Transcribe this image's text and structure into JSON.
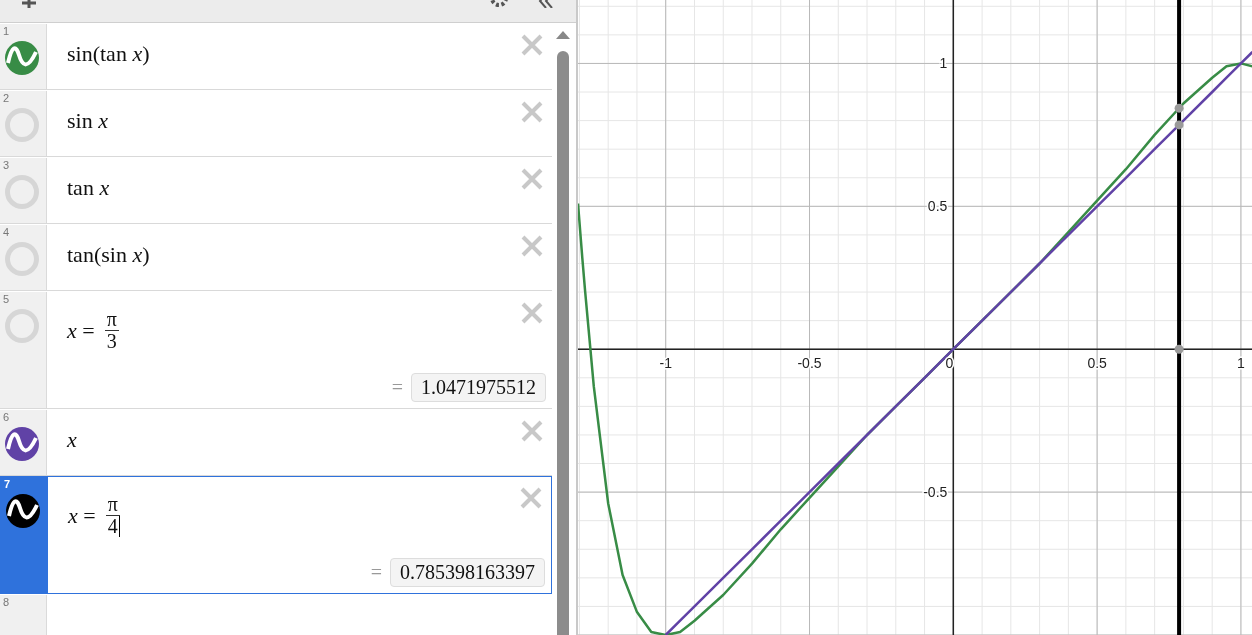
{
  "expressions": [
    {
      "number": "1",
      "kind": "plain",
      "text": "sin(tan *x*)",
      "visible": true,
      "color": "#388c46",
      "selected": false
    },
    {
      "number": "2",
      "kind": "plain",
      "text": "sin *x*",
      "visible": false,
      "selected": false
    },
    {
      "number": "3",
      "kind": "plain",
      "text": "tan *x*",
      "visible": false,
      "selected": false
    },
    {
      "number": "4",
      "kind": "plain",
      "text": "tan(sin *x*)",
      "visible": false,
      "selected": false
    },
    {
      "number": "5",
      "kind": "fraction",
      "lhs": "*x* =",
      "numerator": "π",
      "denominator": "3",
      "equals": "=",
      "result": "1.0471975512",
      "visible": false,
      "selected": false
    },
    {
      "number": "6",
      "kind": "plain",
      "text": "*x*",
      "visible": true,
      "color": "#6042a6",
      "selected": false
    },
    {
      "number": "7",
      "kind": "fraction",
      "lhs": "*x* =",
      "numerator": "π",
      "denominator": "4",
      "equals": "=",
      "result": "0.785398163397",
      "visible": true,
      "color": "#000000",
      "selected": true
    },
    {
      "number": "8",
      "kind": "empty",
      "selected": false
    }
  ],
  "graph": {
    "chart_data": {
      "type": "line",
      "grid": true,
      "xlim": [
        -1.305,
        1.042
      ],
      "ylim": [
        -1.0,
        1.222
      ],
      "xticks": [
        {
          "value": -1,
          "label": "-1"
        },
        {
          "value": -0.5,
          "label": "-0.5"
        },
        {
          "value": 0,
          "label": "0"
        },
        {
          "value": 0.5,
          "label": "0.5"
        },
        {
          "value": 1,
          "label": "1"
        }
      ],
      "yticks": [
        {
          "value": -0.5,
          "label": "-0.5"
        },
        {
          "value": 0.5,
          "label": "0.5"
        },
        {
          "value": 1,
          "label": "1"
        }
      ],
      "x": [
        -1.305,
        -1.29,
        -1.28,
        -1.25,
        -1.2,
        -1.15,
        -1.1,
        -1.05,
        -1,
        -0.95,
        -0.9,
        -0.8,
        -0.7,
        -0.6,
        -0.5,
        -0.4,
        -0.3,
        -0.2,
        -0.1,
        0,
        0.1,
        0.2,
        0.3,
        0.4,
        0.5,
        0.6,
        0.7,
        0.8,
        0.9,
        0.95,
        1,
        1.04
      ],
      "series": [
        {
          "color": "#388c46",
          "values": [
            0.51,
            0.32,
            0.2,
            -0.13,
            -0.54,
            -0.79,
            -0.92,
            -0.99,
            -1.0,
            -0.99,
            -0.95,
            -0.86,
            -0.75,
            -0.63,
            -0.52,
            -0.41,
            -0.3,
            -0.2,
            -0.1,
            0,
            0.1,
            0.2,
            0.3,
            0.41,
            0.52,
            0.63,
            0.75,
            0.86,
            0.95,
            0.99,
            1.0,
            0.99
          ]
        },
        {
          "color": "#6042a6",
          "values": [
            null,
            null,
            null,
            null,
            null,
            null,
            null,
            null,
            -1,
            -0.95,
            -0.9,
            -0.8,
            -0.7,
            -0.6,
            -0.5,
            -0.4,
            -0.3,
            -0.2,
            -0.1,
            0,
            0.1,
            0.2,
            0.3,
            0.4,
            0.5,
            0.6,
            0.7,
            0.8,
            0.9,
            0.95,
            1,
            1.04
          ]
        }
      ],
      "ref_lines": [
        {
          "axis": "x",
          "value": 0.785,
          "color": "#000000"
        }
      ]
    }
  }
}
